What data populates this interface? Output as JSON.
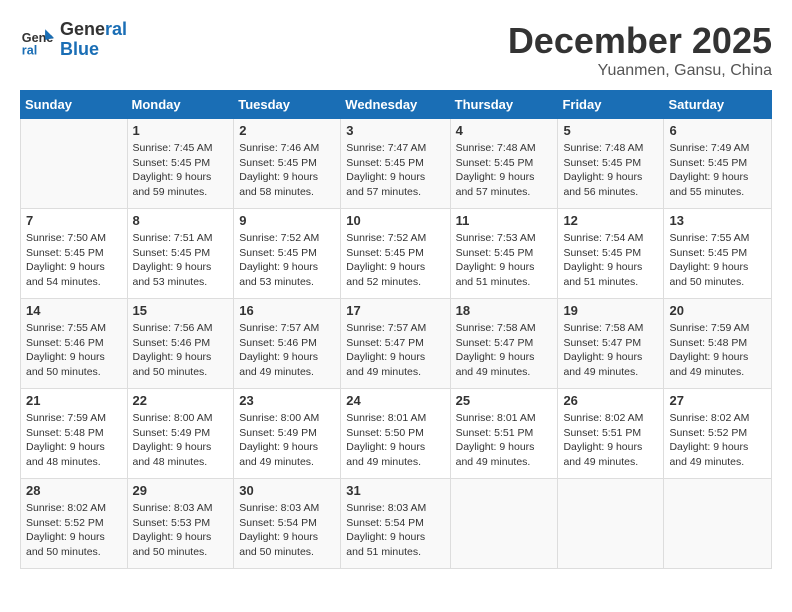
{
  "header": {
    "logo_line1": "General",
    "logo_line2": "Blue",
    "month": "December 2025",
    "location": "Yuanmen, Gansu, China"
  },
  "weekdays": [
    "Sunday",
    "Monday",
    "Tuesday",
    "Wednesday",
    "Thursday",
    "Friday",
    "Saturday"
  ],
  "weeks": [
    [
      {
        "day": "",
        "text": ""
      },
      {
        "day": "1",
        "text": "Sunrise: 7:45 AM\nSunset: 5:45 PM\nDaylight: 9 hours\nand 59 minutes."
      },
      {
        "day": "2",
        "text": "Sunrise: 7:46 AM\nSunset: 5:45 PM\nDaylight: 9 hours\nand 58 minutes."
      },
      {
        "day": "3",
        "text": "Sunrise: 7:47 AM\nSunset: 5:45 PM\nDaylight: 9 hours\nand 57 minutes."
      },
      {
        "day": "4",
        "text": "Sunrise: 7:48 AM\nSunset: 5:45 PM\nDaylight: 9 hours\nand 57 minutes."
      },
      {
        "day": "5",
        "text": "Sunrise: 7:48 AM\nSunset: 5:45 PM\nDaylight: 9 hours\nand 56 minutes."
      },
      {
        "day": "6",
        "text": "Sunrise: 7:49 AM\nSunset: 5:45 PM\nDaylight: 9 hours\nand 55 minutes."
      }
    ],
    [
      {
        "day": "7",
        "text": "Sunrise: 7:50 AM\nSunset: 5:45 PM\nDaylight: 9 hours\nand 54 minutes."
      },
      {
        "day": "8",
        "text": "Sunrise: 7:51 AM\nSunset: 5:45 PM\nDaylight: 9 hours\nand 53 minutes."
      },
      {
        "day": "9",
        "text": "Sunrise: 7:52 AM\nSunset: 5:45 PM\nDaylight: 9 hours\nand 53 minutes."
      },
      {
        "day": "10",
        "text": "Sunrise: 7:52 AM\nSunset: 5:45 PM\nDaylight: 9 hours\nand 52 minutes."
      },
      {
        "day": "11",
        "text": "Sunrise: 7:53 AM\nSunset: 5:45 PM\nDaylight: 9 hours\nand 51 minutes."
      },
      {
        "day": "12",
        "text": "Sunrise: 7:54 AM\nSunset: 5:45 PM\nDaylight: 9 hours\nand 51 minutes."
      },
      {
        "day": "13",
        "text": "Sunrise: 7:55 AM\nSunset: 5:45 PM\nDaylight: 9 hours\nand 50 minutes."
      }
    ],
    [
      {
        "day": "14",
        "text": "Sunrise: 7:55 AM\nSunset: 5:46 PM\nDaylight: 9 hours\nand 50 minutes."
      },
      {
        "day": "15",
        "text": "Sunrise: 7:56 AM\nSunset: 5:46 PM\nDaylight: 9 hours\nand 50 minutes."
      },
      {
        "day": "16",
        "text": "Sunrise: 7:57 AM\nSunset: 5:46 PM\nDaylight: 9 hours\nand 49 minutes."
      },
      {
        "day": "17",
        "text": "Sunrise: 7:57 AM\nSunset: 5:47 PM\nDaylight: 9 hours\nand 49 minutes."
      },
      {
        "day": "18",
        "text": "Sunrise: 7:58 AM\nSunset: 5:47 PM\nDaylight: 9 hours\nand 49 minutes."
      },
      {
        "day": "19",
        "text": "Sunrise: 7:58 AM\nSunset: 5:47 PM\nDaylight: 9 hours\nand 49 minutes."
      },
      {
        "day": "20",
        "text": "Sunrise: 7:59 AM\nSunset: 5:48 PM\nDaylight: 9 hours\nand 49 minutes."
      }
    ],
    [
      {
        "day": "21",
        "text": "Sunrise: 7:59 AM\nSunset: 5:48 PM\nDaylight: 9 hours\nand 48 minutes."
      },
      {
        "day": "22",
        "text": "Sunrise: 8:00 AM\nSunset: 5:49 PM\nDaylight: 9 hours\nand 48 minutes."
      },
      {
        "day": "23",
        "text": "Sunrise: 8:00 AM\nSunset: 5:49 PM\nDaylight: 9 hours\nand 49 minutes."
      },
      {
        "day": "24",
        "text": "Sunrise: 8:01 AM\nSunset: 5:50 PM\nDaylight: 9 hours\nand 49 minutes."
      },
      {
        "day": "25",
        "text": "Sunrise: 8:01 AM\nSunset: 5:51 PM\nDaylight: 9 hours\nand 49 minutes."
      },
      {
        "day": "26",
        "text": "Sunrise: 8:02 AM\nSunset: 5:51 PM\nDaylight: 9 hours\nand 49 minutes."
      },
      {
        "day": "27",
        "text": "Sunrise: 8:02 AM\nSunset: 5:52 PM\nDaylight: 9 hours\nand 49 minutes."
      }
    ],
    [
      {
        "day": "28",
        "text": "Sunrise: 8:02 AM\nSunset: 5:52 PM\nDaylight: 9 hours\nand 50 minutes."
      },
      {
        "day": "29",
        "text": "Sunrise: 8:03 AM\nSunset: 5:53 PM\nDaylight: 9 hours\nand 50 minutes."
      },
      {
        "day": "30",
        "text": "Sunrise: 8:03 AM\nSunset: 5:54 PM\nDaylight: 9 hours\nand 50 minutes."
      },
      {
        "day": "31",
        "text": "Sunrise: 8:03 AM\nSunset: 5:54 PM\nDaylight: 9 hours\nand 51 minutes."
      },
      {
        "day": "",
        "text": ""
      },
      {
        "day": "",
        "text": ""
      },
      {
        "day": "",
        "text": ""
      }
    ]
  ]
}
